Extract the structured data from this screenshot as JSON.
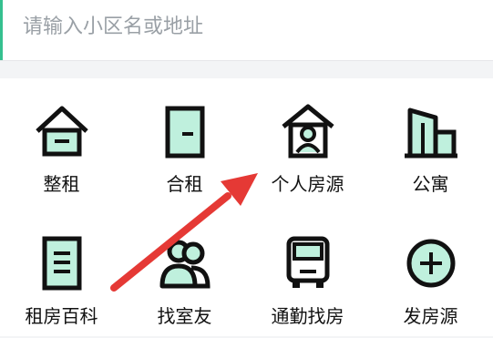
{
  "search": {
    "placeholder": "请输入小区名或地址"
  },
  "colors": {
    "accent": "#35c08f",
    "icon_fill": "#bff0dd",
    "annotation_arrow": "#e53935"
  },
  "menu": [
    {
      "label": "整租",
      "icon": "house-icon"
    },
    {
      "label": "合租",
      "icon": "door-icon"
    },
    {
      "label": "个人房源",
      "icon": "person-house-icon"
    },
    {
      "label": "公寓",
      "icon": "apartment-building-icon"
    },
    {
      "label": "租房百科",
      "icon": "document-icon"
    },
    {
      "label": "找室友",
      "icon": "roommates-icon"
    },
    {
      "label": "通勤找房",
      "icon": "bus-icon"
    },
    {
      "label": "发房源",
      "icon": "add-circle-icon"
    }
  ]
}
